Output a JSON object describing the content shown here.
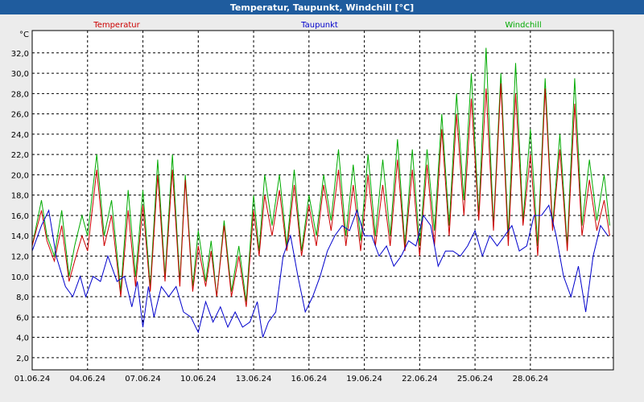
{
  "window": {
    "title": "Temperatur, Taupunkt, Windchill [°C]"
  },
  "chart_data": {
    "type": "line",
    "title": "Temperatur, Taupunkt, Windchill [°C]",
    "ylabel": "°C",
    "xlabel": "",
    "ylim": [
      0.8,
      34.2
    ],
    "xlim": [
      0,
      31.5
    ],
    "grid": true,
    "legend_placement": "top",
    "yticks": [
      2.0,
      4.0,
      6.0,
      8.0,
      10.0,
      12.0,
      14.0,
      16.0,
      18.0,
      20.0,
      22.0,
      24.0,
      26.0,
      28.0,
      30.0,
      32.0
    ],
    "ytick_labels": [
      "2,0",
      "4,0",
      "6,0",
      "8,0",
      "10,0",
      "12,0",
      "14,0",
      "16,0",
      "18,0",
      "20,0",
      "22,0",
      "24,0",
      "26,0",
      "28,0",
      "30,0",
      "32,0"
    ],
    "xticks": [
      0,
      3,
      6,
      9,
      12,
      15,
      18,
      21,
      24,
      27
    ],
    "xtick_labels": [
      "01.06.24",
      "04.06.24",
      "07.06.24",
      "10.06.24",
      "13.06.24",
      "16.06.24",
      "19.06.24",
      "22.06.24",
      "25.06.24",
      "28.06.24"
    ],
    "series": [
      {
        "name": "Temperatur",
        "color": "#cc0000",
        "x": [
          0,
          0.5,
          0.8,
          1.2,
          1.6,
          2.0,
          2.3,
          2.7,
          3.0,
          3.5,
          3.9,
          4.3,
          4.8,
          5.2,
          5.6,
          6.0,
          6.4,
          6.8,
          7.2,
          7.6,
          8.0,
          8.3,
          8.7,
          9.0,
          9.4,
          9.7,
          10.0,
          10.4,
          10.8,
          11.2,
          11.6,
          12.0,
          12.3,
          12.6,
          13.0,
          13.4,
          13.8,
          14.2,
          14.6,
          15.0,
          15.4,
          15.8,
          16.2,
          16.6,
          17.0,
          17.4,
          17.8,
          18.2,
          18.6,
          19.0,
          19.4,
          19.8,
          20.2,
          20.6,
          21.0,
          21.4,
          21.8,
          22.2,
          22.6,
          23.0,
          23.4,
          23.8,
          24.2,
          24.6,
          25.0,
          25.4,
          25.8,
          26.2,
          26.6,
          27.0,
          27.4,
          27.8,
          28.2,
          28.6,
          29.0,
          29.4,
          29.8,
          30.2,
          30.6,
          31.0,
          31.3
        ],
        "y": [
          13.0,
          16.5,
          13.5,
          11.5,
          15.0,
          9.5,
          11.5,
          14.0,
          12.5,
          20.5,
          13.0,
          16.0,
          8.0,
          16.5,
          9.0,
          17.0,
          8.5,
          20.0,
          9.5,
          20.5,
          9.0,
          19.5,
          8.5,
          13.0,
          9.0,
          12.5,
          8.0,
          15.0,
          8.0,
          12.0,
          7.0,
          16.5,
          12.0,
          18.0,
          14.0,
          18.5,
          12.5,
          19.0,
          12.0,
          17.0,
          13.0,
          19.0,
          14.5,
          20.5,
          13.0,
          19.0,
          12.5,
          20.0,
          13.0,
          19.0,
          13.0,
          21.5,
          12.5,
          20.5,
          12.0,
          21.0,
          13.0,
          24.5,
          14.0,
          26.0,
          16.0,
          27.5,
          15.5,
          28.5,
          14.5,
          29.0,
          13.0,
          28.0,
          15.0,
          22.0,
          12.0,
          28.5,
          14.5,
          22.5,
          12.5,
          27.0,
          14.0,
          19.5,
          14.5,
          17.5,
          14.0
        ]
      },
      {
        "name": "Taupunkt",
        "color": "#0000cc",
        "x": [
          0,
          0.5,
          0.9,
          1.3,
          1.8,
          2.2,
          2.6,
          2.9,
          3.3,
          3.7,
          4.1,
          4.6,
          5.0,
          5.4,
          5.7,
          6.0,
          6.3,
          6.6,
          7.0,
          7.4,
          7.8,
          8.2,
          8.6,
          9.0,
          9.4,
          9.8,
          10.2,
          10.6,
          11.0,
          11.4,
          11.8,
          12.2,
          12.5,
          12.8,
          13.2,
          13.6,
          14.0,
          14.4,
          14.8,
          15.2,
          15.6,
          16.0,
          16.4,
          16.8,
          17.2,
          17.6,
          18.0,
          18.4,
          18.8,
          19.2,
          19.6,
          20.0,
          20.4,
          20.8,
          21.2,
          21.6,
          22.0,
          22.4,
          22.8,
          23.2,
          23.6,
          24.0,
          24.4,
          24.8,
          25.2,
          25.6,
          26.0,
          26.4,
          26.8,
          27.2,
          27.6,
          28.0,
          28.4,
          28.8,
          29.2,
          29.6,
          30.0,
          30.4,
          30.8,
          31.2
        ],
        "y": [
          12.5,
          15.0,
          16.5,
          12.0,
          9.0,
          8.0,
          10.0,
          8.0,
          10.0,
          9.5,
          12.0,
          9.5,
          10.0,
          7.0,
          9.5,
          5.0,
          9.0,
          6.0,
          9.0,
          8.0,
          9.0,
          6.5,
          6.0,
          4.5,
          7.5,
          5.5,
          7.0,
          5.0,
          6.5,
          5.0,
          5.5,
          7.5,
          4.0,
          5.5,
          6.5,
          12.0,
          14.0,
          10.0,
          6.5,
          8.0,
          10.0,
          12.5,
          14.0,
          15.0,
          14.5,
          16.5,
          14.0,
          14.0,
          12.0,
          13.0,
          11.0,
          12.0,
          13.5,
          13.0,
          16.0,
          15.0,
          11.0,
          12.5,
          12.5,
          12.0,
          13.0,
          14.5,
          12.0,
          14.0,
          13.0,
          14.0,
          15.0,
          12.5,
          13.0,
          16.0,
          16.0,
          17.0,
          14.0,
          10.0,
          8.0,
          11.0,
          6.5,
          12.0,
          15.0,
          14.0
        ]
      },
      {
        "name": "Windchill",
        "color": "#00aa00",
        "x": [
          0,
          0.5,
          0.8,
          1.2,
          1.6,
          2.0,
          2.3,
          2.7,
          3.0,
          3.5,
          3.9,
          4.3,
          4.8,
          5.2,
          5.6,
          6.0,
          6.4,
          6.8,
          7.2,
          7.6,
          8.0,
          8.3,
          8.7,
          9.0,
          9.4,
          9.7,
          10.0,
          10.4,
          10.8,
          11.2,
          11.6,
          12.0,
          12.3,
          12.6,
          13.0,
          13.4,
          13.8,
          14.2,
          14.6,
          15.0,
          15.4,
          15.8,
          16.2,
          16.6,
          17.0,
          17.4,
          17.8,
          18.2,
          18.6,
          19.0,
          19.4,
          19.8,
          20.2,
          20.6,
          21.0,
          21.4,
          21.8,
          22.2,
          22.6,
          23.0,
          23.4,
          23.8,
          24.2,
          24.6,
          25.0,
          25.4,
          25.8,
          26.2,
          26.6,
          27.0,
          27.4,
          27.8,
          28.2,
          28.6,
          29.0,
          29.4,
          29.8,
          30.2,
          30.6,
          31.0,
          31.3
        ],
        "y": [
          13.0,
          17.5,
          14.0,
          12.0,
          16.5,
          10.0,
          13.0,
          16.0,
          14.0,
          22.0,
          14.0,
          17.5,
          8.5,
          18.5,
          10.0,
          18.5,
          9.0,
          21.5,
          10.0,
          22.0,
          9.5,
          20.0,
          9.0,
          14.5,
          9.5,
          13.5,
          8.0,
          15.5,
          8.5,
          13.0,
          7.5,
          18.0,
          12.5,
          20.0,
          15.0,
          20.0,
          13.0,
          20.5,
          12.5,
          18.0,
          14.0,
          20.0,
          15.5,
          22.5,
          14.0,
          21.0,
          13.5,
          22.0,
          14.0,
          21.5,
          14.0,
          23.5,
          13.0,
          22.5,
          13.0,
          22.5,
          14.5,
          26.0,
          15.0,
          28.0,
          17.5,
          30.0,
          16.0,
          32.5,
          15.0,
          30.0,
          14.0,
          31.0,
          15.5,
          24.5,
          13.0,
          29.5,
          15.0,
          24.0,
          13.0,
          29.5,
          15.0,
          21.5,
          15.5,
          20.0,
          15.0
        ]
      }
    ]
  }
}
